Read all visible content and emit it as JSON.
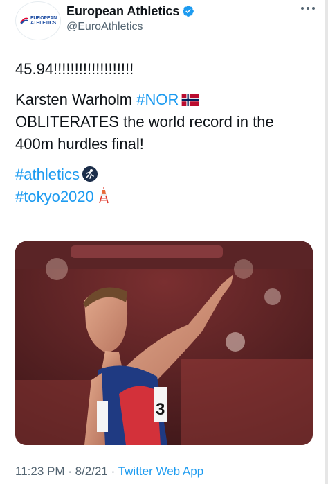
{
  "account": {
    "display_name": "European Athletics",
    "handle": "@EuroAthletics",
    "avatar_text_line1": "EUROPEAN",
    "avatar_text_line2": "ATHLETICS"
  },
  "tweet": {
    "line1": "45.94!!!!!!!!!!!!!!!!!!!",
    "line2_prefix": "Karsten Warholm ",
    "line2_hashtag": "#NOR",
    "line3": "OBLITERATES the world record in the",
    "line4": "400m hurdles final!",
    "hashtag_athletics": "#athletics",
    "hashtag_tokyo": "#tokyo2020"
  },
  "image": {
    "bib_number": "3"
  },
  "meta": {
    "time": "11:23 PM",
    "sep1": " · ",
    "date": "8/2/21",
    "sep2": " · ",
    "app": "Twitter Web App"
  },
  "icons": {
    "verified": "verified-badge-icon",
    "more": "more-options-icon",
    "flag": "norway-flag-icon",
    "athletics": "athletics-runner-icon",
    "tower": "tokyo-tower-icon"
  },
  "colors": {
    "link": "#1d9bf0",
    "muted": "#536471",
    "text": "#0f1419"
  }
}
